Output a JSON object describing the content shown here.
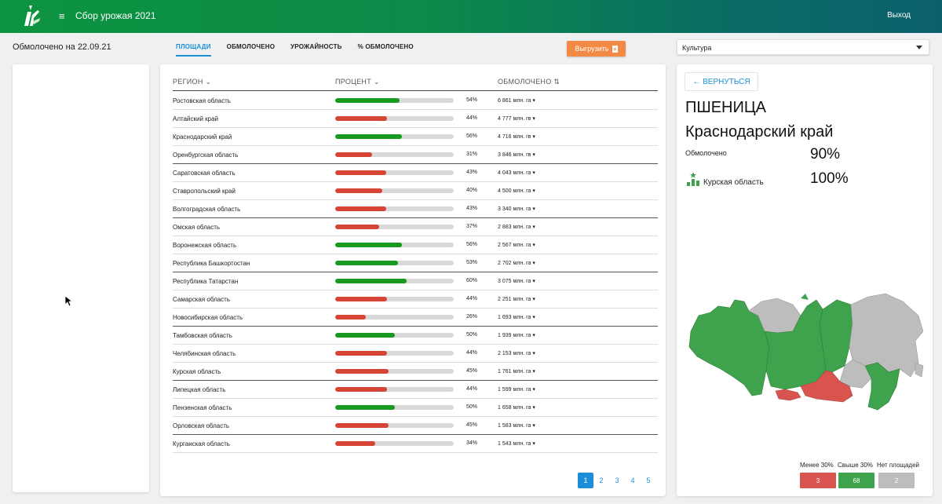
{
  "app": {
    "title": "Сбор урожая 2021",
    "logout_label": "Выход",
    "brand_colors": {
      "header_start": "#0d9440",
      "header_end": "#0b5f6d"
    }
  },
  "toolbar": {
    "updated_label": "Обмолочено на 22.09.21",
    "tabs": [
      {
        "label": "ПЛОЩАДИ",
        "active": true
      },
      {
        "label": "ОБМОЛОЧЕНО",
        "active": false
      },
      {
        "label": "УРОЖАЙНОСТЬ",
        "active": false
      },
      {
        "label": "% ОБМОЛОЧЕНО",
        "active": false
      }
    ],
    "export_label": "Выгрузить",
    "culture_select_value": "Культура"
  },
  "table": {
    "headers": {
      "region": "РЕГИОН",
      "region_sort_icon": "⌄",
      "percent": "ПРОЦЕНТ",
      "percent_sort_icon": "⌄",
      "done": "ОБМОЛОЧЕНО",
      "done_sort_icon": "⇅"
    },
    "colors": {
      "high": "#18991f",
      "low": "#d64436",
      "track": "#d9d9d9"
    },
    "rows": [
      {
        "region": "Ростовская область",
        "percent": 54,
        "percent_label": "54%",
        "done": "6 861 млн. га ▾",
        "status": "high"
      },
      {
        "region": "Алтайский край",
        "percent": 44,
        "percent_label": "44%",
        "done": "4 777 млн. гв ▾",
        "status": "low"
      },
      {
        "region": "Краснодарский край",
        "percent": 56,
        "percent_label": "56%",
        "done": "4 716 млн. гв ▾",
        "status": "high"
      },
      {
        "region": "Оренбургская область",
        "percent": 31,
        "percent_label": "31%",
        "done": "3 846 млн. гв ▾",
        "status": "low"
      },
      {
        "region": "Саратовская область",
        "percent": 43,
        "percent_label": "43%",
        "done": "4 043 млн. га ▾",
        "status": "low"
      },
      {
        "region": "Ставропольский край",
        "percent": 40,
        "percent_label": "40%",
        "done": "4 500 млн. га ▾",
        "status": "low"
      },
      {
        "region": "Волгоградская область",
        "percent": 43,
        "percent_label": "43%",
        "done": "3 340 млн. га ▾",
        "status": "low"
      },
      {
        "region": "Омская область",
        "percent": 37,
        "percent_label": "37%",
        "done": "2 883 млн. га ▾",
        "status": "low"
      },
      {
        "region": "Воронежская область",
        "percent": 56,
        "percent_label": "56%",
        "done": "2 567 млн. га ▾",
        "status": "high"
      },
      {
        "region": "Республика Башкортостан",
        "percent": 53,
        "percent_label": "53%",
        "done": "2 702 млн. га ▾",
        "status": "high"
      },
      {
        "region": "Республика Татарстан",
        "percent": 60,
        "percent_label": "60%",
        "done": "3 075 млн. га ▾",
        "status": "high"
      },
      {
        "region": "Самарская область",
        "percent": 44,
        "percent_label": "44%",
        "done": "2 251 млн. га ▾",
        "status": "low"
      },
      {
        "region": "Новосибирская область",
        "percent": 26,
        "percent_label": "26%",
        "done": "1 693 млн. га ▾",
        "status": "low"
      },
      {
        "region": "Тамбовская область",
        "percent": 50,
        "percent_label": "50%",
        "done": "1 939 млн. га ▾",
        "status": "high"
      },
      {
        "region": "Челябинская область",
        "percent": 44,
        "percent_label": "44%",
        "done": "2 153 млн. га ▾",
        "status": "low"
      },
      {
        "region": "Курская область",
        "percent": 45,
        "percent_label": "45%",
        "done": "1 761 млн. га ▾",
        "status": "low"
      },
      {
        "region": "Липецкая область",
        "percent": 44,
        "percent_label": "44%",
        "done": "1 599 млн. га ▾",
        "status": "low"
      },
      {
        "region": "Пензенская область",
        "percent": 50,
        "percent_label": "50%",
        "done": "1 658 млн. га ▾",
        "status": "high"
      },
      {
        "region": "Орловская область",
        "percent": 45,
        "percent_label": "45%",
        "done": "1 583 млн. га ▾",
        "status": "low"
      },
      {
        "region": "Курганская область",
        "percent": 34,
        "percent_label": "34%",
        "done": "1 543 млн. га ▾",
        "status": "low"
      }
    ],
    "pages": [
      "1",
      "2",
      "3",
      "4",
      "5"
    ],
    "active_page": "1"
  },
  "details": {
    "back_label": "← ВЕРНУТЬСЯ",
    "crop": "ПШЕНИЦА",
    "region": "Краснодарский край",
    "stat_label": "Обмолочено",
    "stat_value": "90%",
    "leader_label": "Курская область",
    "leader_value": "100%",
    "legend": {
      "labels": [
        "Менее 30%",
        "Свыше 30%",
        "Нет площадей"
      ],
      "counts": [
        "3",
        "68",
        "2"
      ],
      "colors": [
        "#d9534f",
        "#3fa34d",
        "#bdbdbd"
      ]
    }
  }
}
